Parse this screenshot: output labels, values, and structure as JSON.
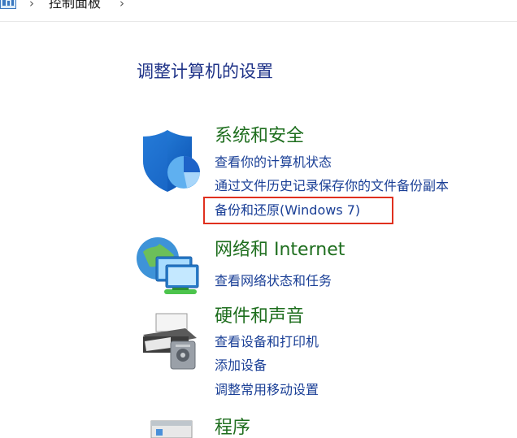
{
  "breadcrumb": {
    "current": "控制面板"
  },
  "main": {
    "title": "调整计算机的设置"
  },
  "categories": [
    {
      "title": "系统和安全",
      "icon": "shield-icon",
      "links": [
        "查看你的计算机状态",
        "通过文件历史记录保存你的文件备份副本",
        "备份和还原(Windows 7)"
      ]
    },
    {
      "title": "网络和 Internet",
      "icon": "network-globe-icon",
      "links": [
        "查看网络状态和任务"
      ]
    },
    {
      "title": "硬件和声音",
      "icon": "printer-icon",
      "links": [
        "查看设备和打印机",
        "添加设备",
        "调整常用移动设置"
      ]
    },
    {
      "title": "程序",
      "icon": "programs-icon",
      "links": []
    }
  ],
  "colors": {
    "title": "#1e3287",
    "category_title": "#1e6e1e",
    "link": "#1a3f96",
    "highlight": "#e0301e"
  }
}
